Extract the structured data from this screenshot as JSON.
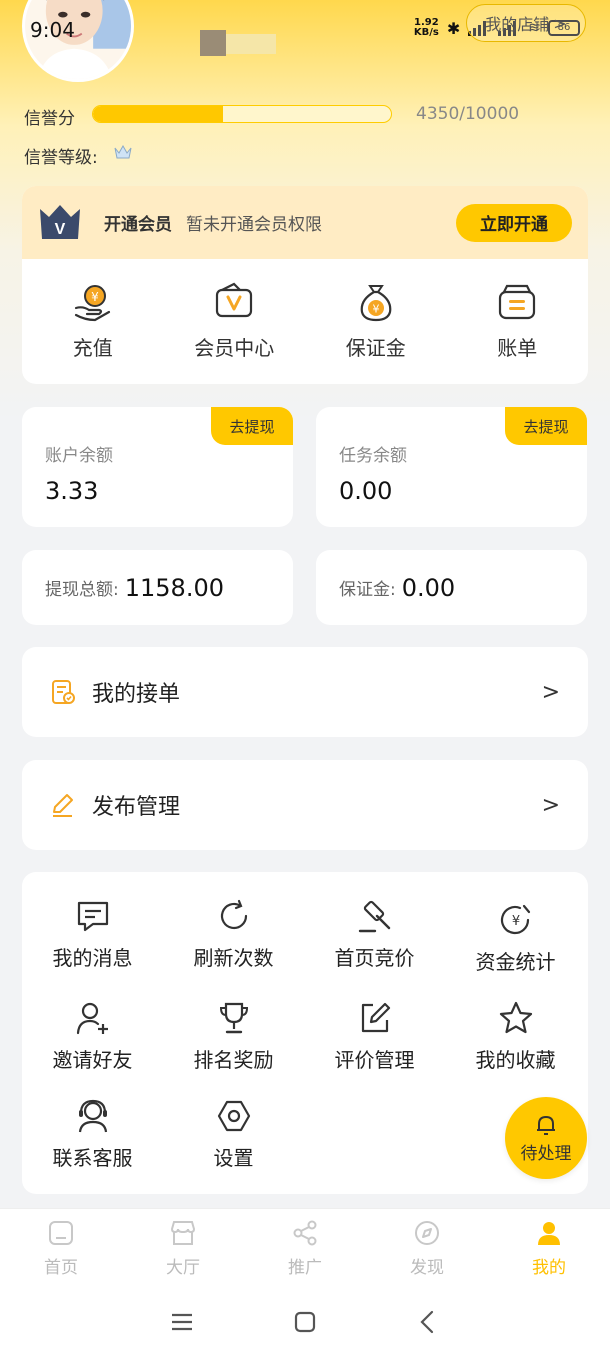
{
  "status": {
    "time": "9:04",
    "speed_value": "1.92",
    "speed_unit": "KB/s",
    "battery": "86"
  },
  "header": {
    "store_button": "我的店铺",
    "store_chevron": ">"
  },
  "credit": {
    "label": "信誉分",
    "value_text": "4350/10000",
    "progress": 0.435,
    "level_label": "信誉等级:",
    "level_icon": "crown-icon"
  },
  "member": {
    "badge_letter": "V",
    "title": "开通会员",
    "description": "暂未开通会员权限",
    "button": "立即开通",
    "quick_actions": [
      {
        "label": "充值",
        "icon": "recharge-icon"
      },
      {
        "label": "会员中心",
        "icon": "member-center-icon"
      },
      {
        "label": "保证金",
        "icon": "money-bag-icon"
      },
      {
        "label": "账单",
        "icon": "bill-icon"
      }
    ]
  },
  "balances": {
    "account": {
      "label": "账户余额",
      "value": "3.33",
      "tag": "去提现"
    },
    "task": {
      "label": "任务余额",
      "value": "0.00",
      "tag": "去提现"
    },
    "withdraw_total": {
      "label": "提现总额:",
      "value": "1158.00"
    },
    "deposit": {
      "label": "保证金:",
      "value": "0.00"
    }
  },
  "rows": {
    "my_orders": {
      "label": "我的接单",
      "chevron": ">"
    },
    "publish": {
      "label": "发布管理",
      "chevron": ">"
    }
  },
  "grid": [
    {
      "label": "我的消息",
      "icon": "message-icon"
    },
    {
      "label": "刷新次数",
      "icon": "refresh-icon"
    },
    {
      "label": "首页竞价",
      "icon": "gavel-icon"
    },
    {
      "label": "资金统计",
      "icon": "fund-stats-icon"
    },
    {
      "label": "邀请好友",
      "icon": "invite-user-icon"
    },
    {
      "label": "排名奖励",
      "icon": "trophy-icon"
    },
    {
      "label": "评价管理",
      "icon": "edit-review-icon"
    },
    {
      "label": "我的收藏",
      "icon": "star-icon"
    },
    {
      "label": "联系客服",
      "icon": "support-icon"
    },
    {
      "label": "设置",
      "icon": "settings-icon"
    }
  ],
  "pending": {
    "label": "待处理",
    "icon": "bell-icon"
  },
  "tabs": [
    {
      "label": "首页",
      "icon": "home-icon",
      "active": false
    },
    {
      "label": "大厅",
      "icon": "hall-icon",
      "active": false
    },
    {
      "label": "推广",
      "icon": "share-icon",
      "active": false
    },
    {
      "label": "发现",
      "icon": "compass-icon",
      "active": false
    },
    {
      "label": "我的",
      "icon": "profile-icon",
      "active": true
    }
  ],
  "colors": {
    "accent": "#ffc800",
    "member_banner": "#ffecc4",
    "icon_orange": "#f5a623"
  }
}
